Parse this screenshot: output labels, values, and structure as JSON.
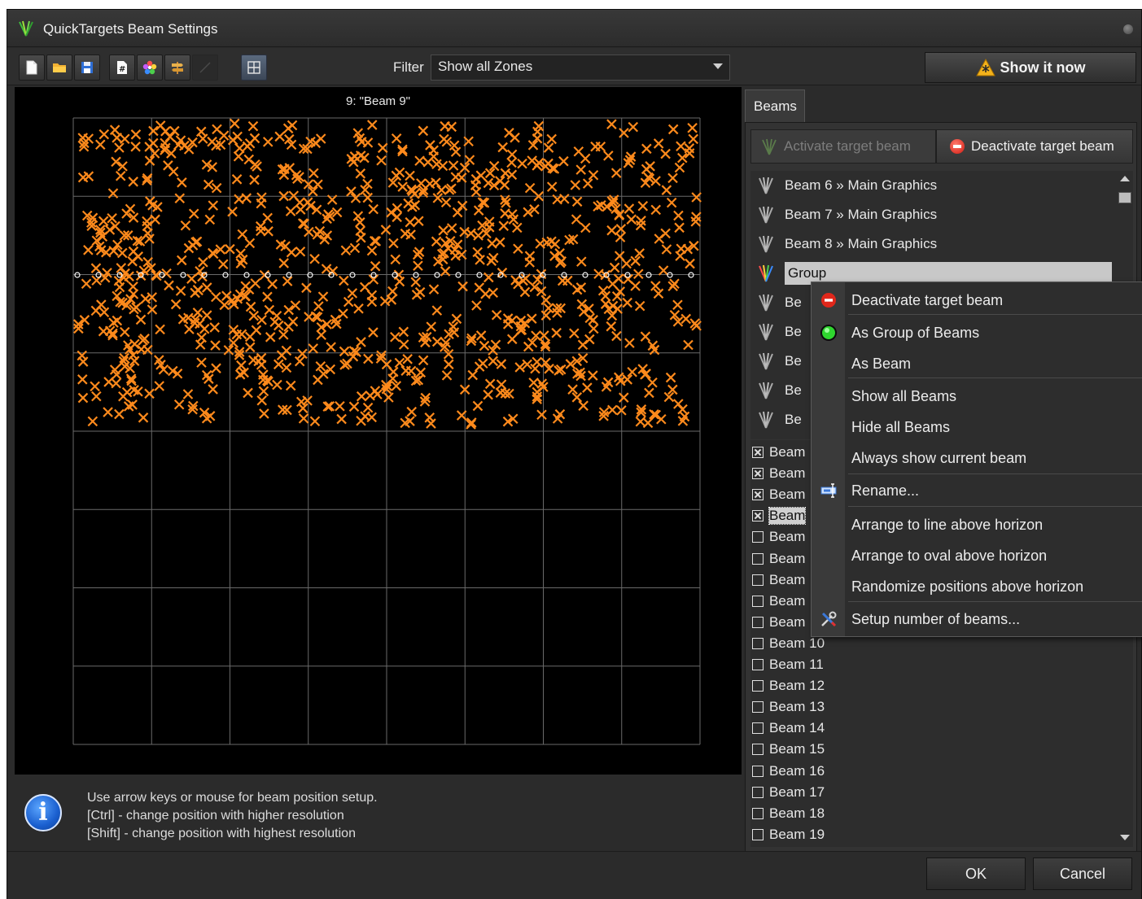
{
  "window": {
    "title": "QuickTargets Beam Settings"
  },
  "toolbar": {
    "buttons": [
      "new-file",
      "open-folder",
      "save",
      "numbering",
      "color-flower",
      "signpost",
      "line-tool",
      "grid-toggle"
    ],
    "filter_label": "Filter",
    "filter_value": "Show all Zones",
    "show_now_label": "Show it now"
  },
  "preview": {
    "title": "9: \"Beam 9\"",
    "grid_cols": 8,
    "grid_rows": 8,
    "marker_color": "#ff8a1c",
    "background": "#000000"
  },
  "info": {
    "lines": [
      "Use arrow keys or mouse for beam position setup.",
      "[Ctrl] - change position with higher resolution",
      "[Shift] - change position with highest resolution"
    ]
  },
  "beams_panel": {
    "tab_label": "Beams",
    "activate_label": "Activate target beam",
    "deactivate_label": "Deactivate target beam",
    "tree_items": [
      {
        "label": "Beam 6 » Main Graphics",
        "selected": false,
        "icon": "beam-icon"
      },
      {
        "label": "Beam 7 » Main Graphics",
        "selected": false,
        "icon": "beam-icon"
      },
      {
        "label": "Beam 8 » Main Graphics",
        "selected": false,
        "icon": "beam-icon"
      },
      {
        "label": "Group",
        "selected": true,
        "icon": "group-beam-icon"
      },
      {
        "label": "Be",
        "selected": false,
        "icon": "beam-icon"
      },
      {
        "label": "Be",
        "selected": false,
        "icon": "beam-icon"
      },
      {
        "label": "Be",
        "selected": false,
        "icon": "beam-icon"
      },
      {
        "label": "Be",
        "selected": false,
        "icon": "beam-icon"
      },
      {
        "label": "Be",
        "selected": false,
        "icon": "beam-icon"
      }
    ],
    "check_items": [
      {
        "label": "Beam",
        "checked": true
      },
      {
        "label": "Beam",
        "checked": true
      },
      {
        "label": "Beam",
        "checked": true
      },
      {
        "label": "Beam",
        "checked": true,
        "focused": true
      },
      {
        "label": "Beam",
        "checked": false
      },
      {
        "label": "Beam",
        "checked": false
      },
      {
        "label": "Beam",
        "checked": false
      },
      {
        "label": "Beam",
        "checked": false
      },
      {
        "label": "Beam",
        "checked": false
      },
      {
        "label": "Beam 10",
        "checked": false
      },
      {
        "label": "Beam 11",
        "checked": false
      },
      {
        "label": "Beam 12",
        "checked": false
      },
      {
        "label": "Beam 13",
        "checked": false
      },
      {
        "label": "Beam 14",
        "checked": false
      },
      {
        "label": "Beam 15",
        "checked": false
      },
      {
        "label": "Beam 16",
        "checked": false
      },
      {
        "label": "Beam 17",
        "checked": false
      },
      {
        "label": "Beam 18",
        "checked": false
      },
      {
        "label": "Beam 19",
        "checked": false
      }
    ]
  },
  "context_menu": {
    "items": [
      {
        "label": "Deactivate target beam",
        "icon": "no-entry-icon"
      },
      {
        "label": "As Group of Beams",
        "icon": "green-light-icon"
      },
      {
        "label": "As Beam",
        "icon": ""
      },
      {
        "label": "Show all Beams",
        "icon": ""
      },
      {
        "label": "Hide all Beams",
        "icon": ""
      },
      {
        "label": "Always show current beam",
        "icon": ""
      },
      {
        "label": "Rename...",
        "icon": "rename-icon"
      },
      {
        "label": "Arrange to line above horizon",
        "icon": ""
      },
      {
        "label": "Arrange to oval above horizon",
        "icon": ""
      },
      {
        "label": "Randomize positions above horizon",
        "icon": ""
      },
      {
        "label": "Setup number of beams...",
        "icon": "tools-icon"
      }
    ]
  },
  "dialog": {
    "ok_label": "OK",
    "cancel_label": "Cancel"
  }
}
